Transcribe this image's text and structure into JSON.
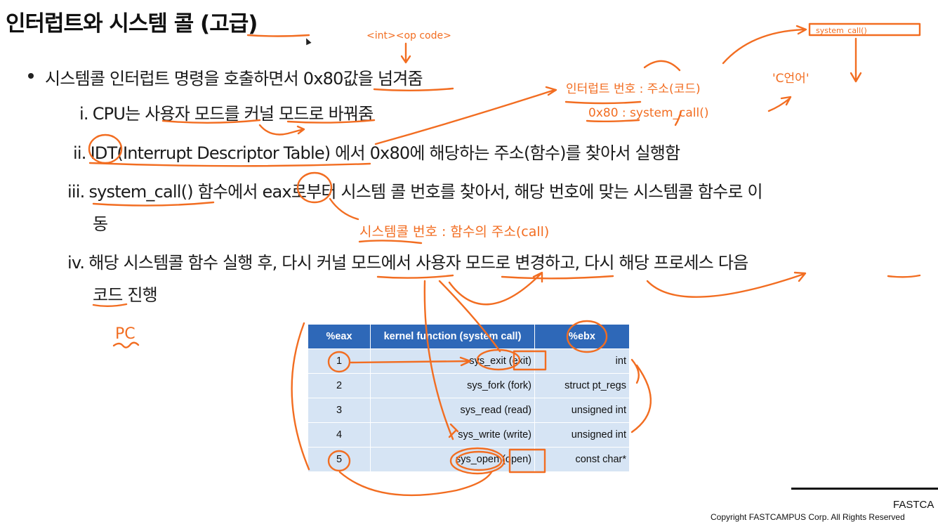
{
  "slide": {
    "title": "인터럽트와 시스템 콜 (고급)",
    "bullet": "시스템콜 인터럽트 명령을 호출하면서 0x80값을 넘겨줌",
    "items": [
      {
        "marker": "i.",
        "text": "CPU는 사용자 모드를 커널 모드로 바꿔줌"
      },
      {
        "marker": "ii.",
        "text": "IDT(Interrupt Descriptor Table) 에서 0x80에 해당하는 주소(함수)를 찾아서 실행함"
      },
      {
        "marker": "iii.",
        "text": "system_call() 함수에서 eax로부터 시스템 콜 번호를 찾아서, 해당 번호에 맞는 시스템콜 함수로 이",
        "text_cont": "동"
      },
      {
        "marker": "iv.",
        "text": "해당 시스템콜 함수 실행 후, 다시 커널 모드에서 사용자 모드로 변경하고, 다시 해당 프로세스 다음",
        "text_cont": "코드 진행"
      }
    ]
  },
  "table": {
    "headers": [
      "%eax",
      "kernel function (system call)",
      "%ebx"
    ],
    "rows": [
      [
        "1",
        "sys_exit (exit)",
        "int"
      ],
      [
        "2",
        "sys_fork (fork)",
        "struct pt_regs"
      ],
      [
        "3",
        "sys_read (read)",
        "unsigned int"
      ],
      [
        "4",
        "sys_write (write)",
        "unsigned int"
      ],
      [
        "5",
        "sys_open (open)",
        "const char*"
      ]
    ]
  },
  "annotations": {
    "int_opcode": "<int><op code>",
    "system_call_box": "system_call()",
    "interrupt_number": "인터럽트 번호 : 주소(코드)",
    "c_language": "'C언어'",
    "hex_mapping": "0x80 : system_call()",
    "syscall_number": "시스템콜 번호 : 함수의 주소(call)",
    "pc": "PC"
  },
  "footer": {
    "brand": "FASTCA",
    "copyright": "Copyright FASTCAMPUS Corp. All Rights Reserved"
  },
  "colors": {
    "ink": "#f26d21",
    "table_header": "#2e68b8",
    "table_cell": "#d6e4f4"
  }
}
